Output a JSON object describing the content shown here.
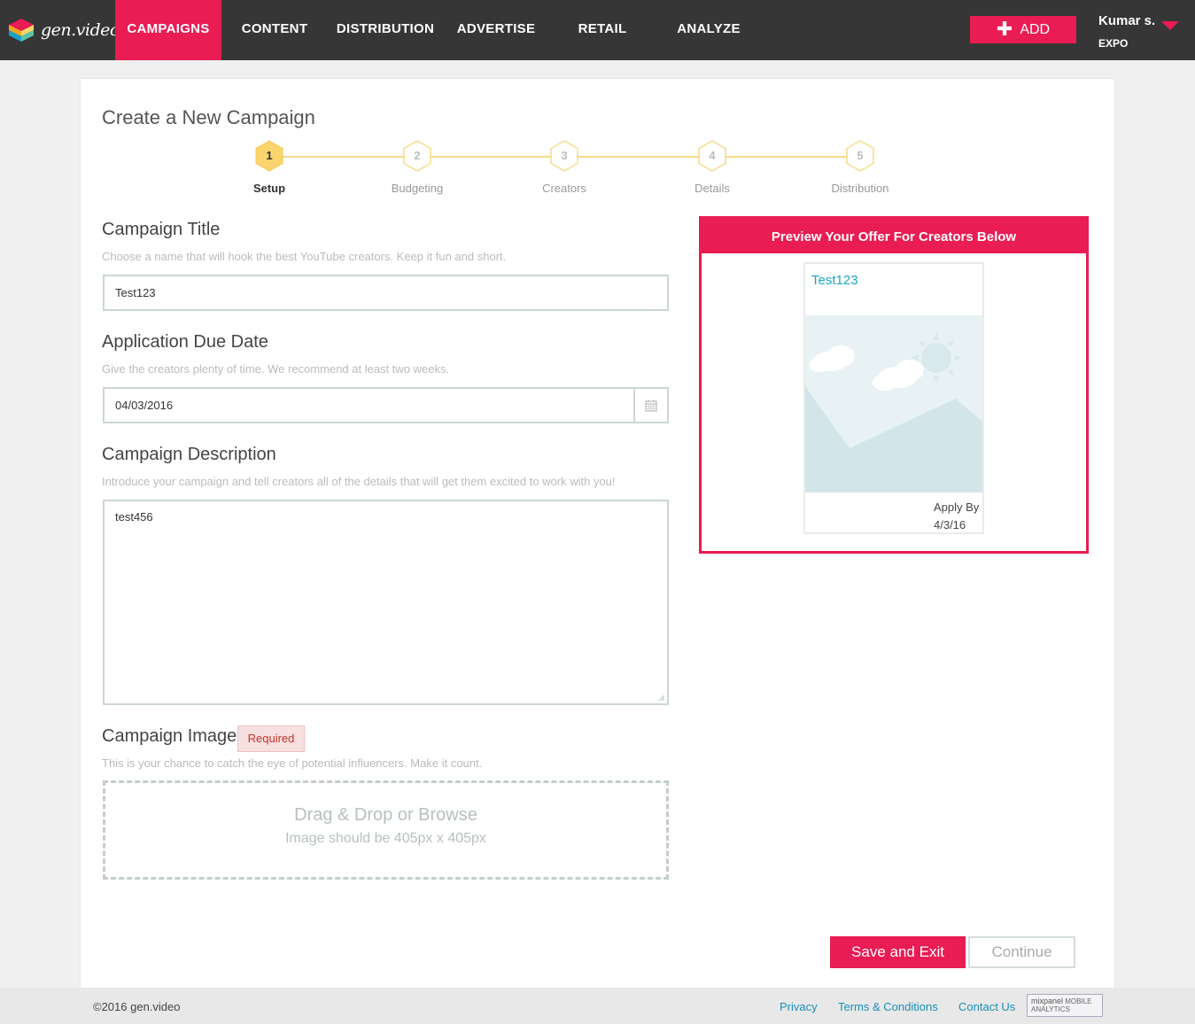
{
  "brand": {
    "logo_text": "gen.video"
  },
  "nav": {
    "items": [
      {
        "label": "CAMPAIGNS",
        "active": true
      },
      {
        "label": "CONTENT",
        "active": false
      },
      {
        "label": "DISTRIBUTION",
        "active": false
      },
      {
        "label": "ADVERTISE",
        "active": false
      },
      {
        "label": "RETAIL",
        "active": false
      },
      {
        "label": "ANALYZE",
        "active": false
      }
    ],
    "add_label": "ADD",
    "user_name": "Kumar s.",
    "user_org": "EXPO"
  },
  "page": {
    "title": "Create a New Campaign"
  },
  "stepper": {
    "current": 1,
    "steps": [
      {
        "num": "1",
        "label": "Setup"
      },
      {
        "num": "2",
        "label": "Budgeting"
      },
      {
        "num": "3",
        "label": "Creators"
      },
      {
        "num": "4",
        "label": "Details"
      },
      {
        "num": "5",
        "label": "Distribution"
      }
    ]
  },
  "form": {
    "title": {
      "label": "Campaign Title",
      "help": "Choose a name that will hook the best YouTube creators. Keep it fun and short.",
      "value": "Test123"
    },
    "due_date": {
      "label": "Application Due Date",
      "help": "Give the creators plenty of time. We recommend at least two weeks.",
      "value": "04/03/2016"
    },
    "description": {
      "label": "Campaign Description",
      "help": "Introduce your campaign and tell creators all of the details that will get them excited to work with you!",
      "value": "test456"
    },
    "image": {
      "label": "Campaign Image",
      "badge": "Required",
      "help": "This is your chance to catch the eye of potential influencers. Make it count.",
      "drop_main": "Drag & Drop or Browse",
      "drop_sub": "Image should be 405px x 405px"
    }
  },
  "preview": {
    "heading": "Preview Your Offer For Creators Below",
    "offer_title": "Test123",
    "apply_label": "Apply By",
    "apply_date": "4/3/16"
  },
  "actions": {
    "save_label": "Save and Exit",
    "continue_label": "Continue"
  },
  "footer": {
    "copyright": "©2016 gen.video",
    "links": [
      "Privacy",
      "Terms & Conditions",
      "Contact Us"
    ],
    "badge_brand": "mixpanel",
    "badge_sub": "MOBILE ANALYTICS"
  },
  "colors": {
    "accent": "#e91c53",
    "nav_bg": "#363636",
    "link": "#1a8fb8",
    "step_active": "#fbd46d",
    "offer_title": "#1aa3c8"
  }
}
